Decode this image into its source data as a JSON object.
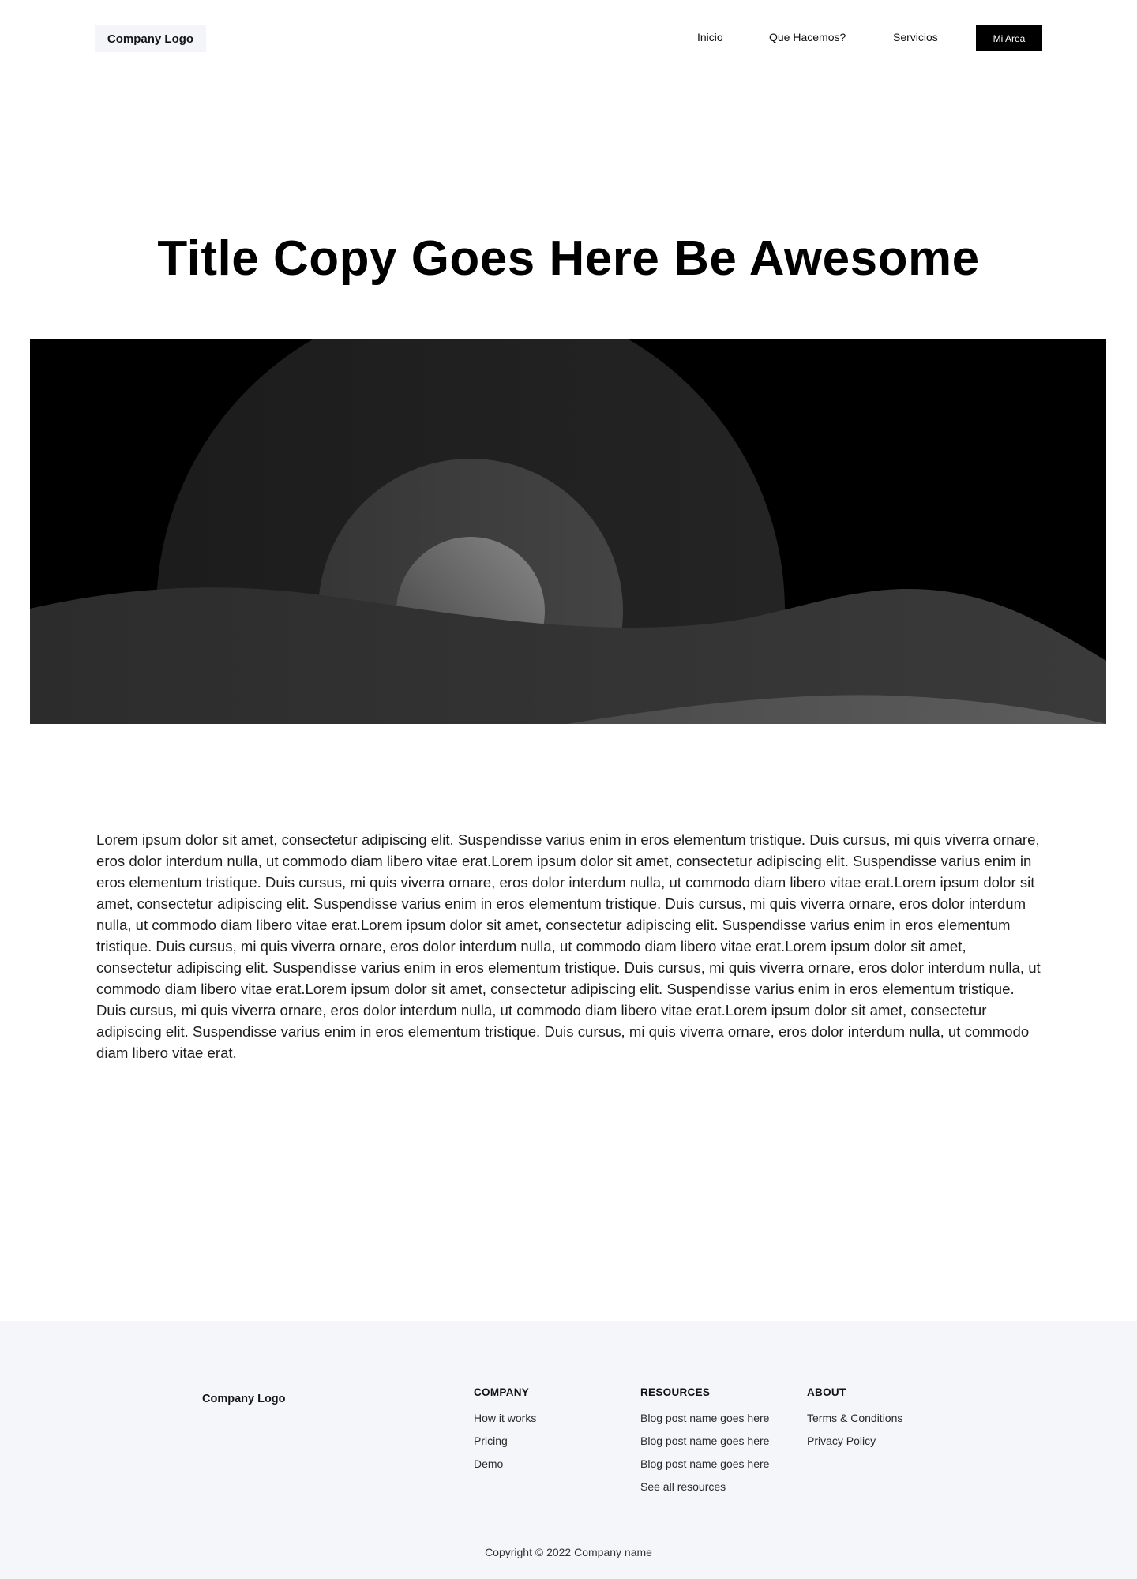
{
  "header": {
    "logo": "Company Logo",
    "nav": {
      "inicio": "Inicio",
      "que_hacemos": "Que Hacemos?",
      "servicios": "Servicios"
    },
    "cta": "Mi Area"
  },
  "hero": {
    "title": "Title Copy Goes Here Be Awesome"
  },
  "content": {
    "paragraph": "Lorem ipsum dolor sit amet, consectetur adipiscing elit. Suspendisse varius enim in eros elementum tristique. Duis cursus, mi quis viverra ornare, eros dolor interdum nulla, ut commodo diam libero vitae erat.Lorem ipsum dolor sit amet, consectetur adipiscing elit. Suspendisse varius enim in eros elementum tristique. Duis cursus, mi quis viverra ornare, eros dolor interdum nulla, ut commodo diam libero vitae erat.Lorem ipsum dolor sit amet, consectetur adipiscing elit. Suspendisse varius enim in eros elementum tristique. Duis cursus, mi quis viverra ornare, eros dolor interdum nulla, ut commodo diam libero vitae erat.Lorem ipsum dolor sit amet, consectetur adipiscing elit. Suspendisse varius enim in eros elementum tristique. Duis cursus, mi quis viverra ornare, eros dolor interdum nulla, ut commodo diam libero vitae erat.Lorem ipsum dolor sit amet, consectetur adipiscing elit. Suspendisse varius enim in eros elementum tristique. Duis cursus, mi quis viverra ornare, eros dolor interdum nulla, ut commodo diam libero vitae erat.Lorem ipsum dolor sit amet, consectetur adipiscing elit. Suspendisse varius enim in eros elementum tristique. Duis cursus, mi quis viverra ornare, eros dolor interdum nulla, ut commodo diam libero vitae erat.Lorem ipsum dolor sit amet, consectetur adipiscing elit. Suspendisse varius enim in eros elementum tristique. Duis cursus, mi quis viverra ornare, eros dolor interdum nulla, ut commodo diam libero vitae erat."
  },
  "footer": {
    "logo": "Company Logo",
    "company": {
      "heading": "COMPANY",
      "links": [
        "How it works",
        "Pricing",
        "Demo"
      ]
    },
    "resources": {
      "heading": "RESOURCES",
      "links": [
        "Blog post name goes here",
        "Blog post name goes here",
        "Blog post name goes here",
        "See all resources"
      ]
    },
    "about": {
      "heading": "ABOUT",
      "links": [
        "Terms & Conditions",
        "Privacy Policy"
      ]
    },
    "copyright": "Copyright © 2022 Company name"
  },
  "colors": {
    "accent": "#000000",
    "footer_bg": "#f4f6f9",
    "logo_bg": "#f4f5f9"
  }
}
